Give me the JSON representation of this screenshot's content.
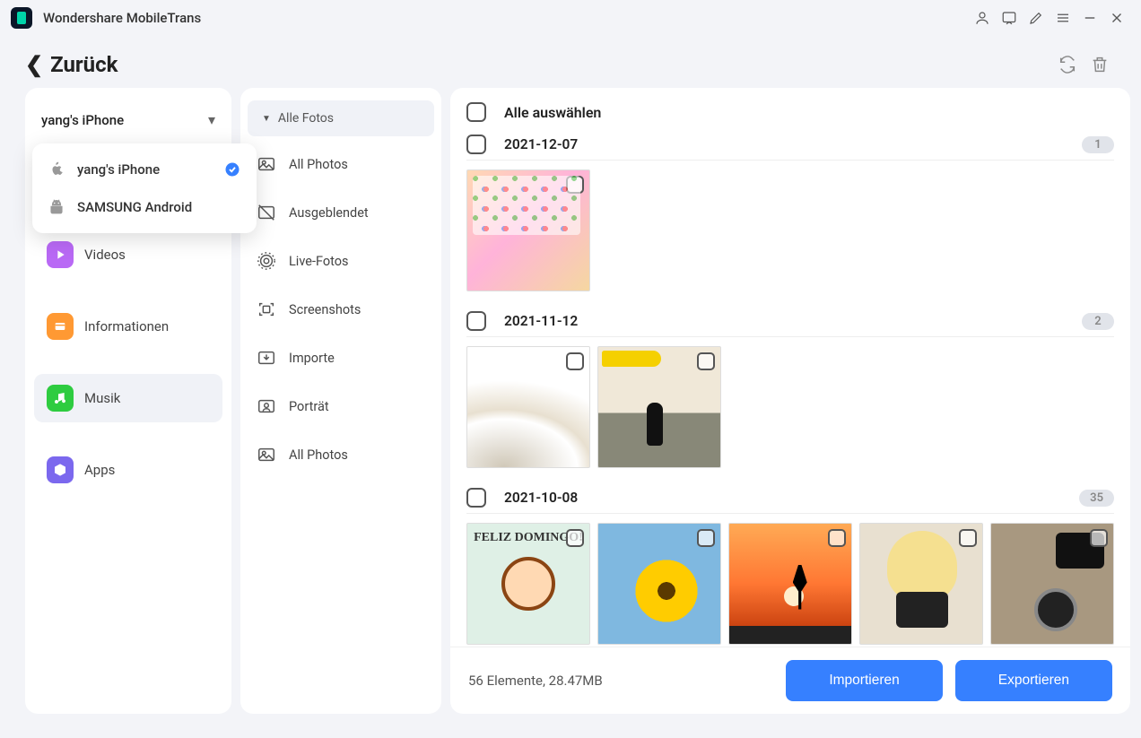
{
  "app": {
    "title": "Wondershare MobileTrans"
  },
  "back": {
    "label": "Zurück"
  },
  "device": {
    "selected": "yang's iPhone",
    "options": [
      "yang's iPhone",
      "SAMSUNG Android"
    ]
  },
  "nav": {
    "videos": "Videos",
    "info": "Informationen",
    "music": "Musik",
    "apps": "Apps"
  },
  "categories": {
    "group": "Alle Fotos",
    "items": [
      "All Photos",
      "Ausgeblendet",
      "Live-Fotos",
      "Screenshots",
      "Importe",
      "Porträt",
      "All Photos"
    ]
  },
  "selectAll": "Alle auswählen",
  "sections": [
    {
      "date": "2021-12-07",
      "count": "1"
    },
    {
      "date": "2021-11-12",
      "count": "2"
    },
    {
      "date": "2021-10-08",
      "count": "35"
    }
  ],
  "felizText": "FELIZ DOMINGO!",
  "footer": {
    "status": "56 Elemente, 28.47MB",
    "import": "Importieren",
    "export": "Exportieren"
  }
}
